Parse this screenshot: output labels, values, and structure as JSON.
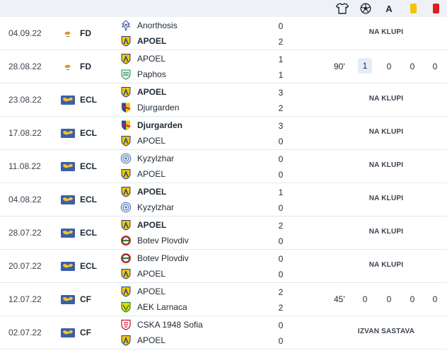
{
  "header_icons": [
    {
      "name": "shirt-icon"
    },
    {
      "name": "ball-icon"
    },
    {
      "name": "assist-icon",
      "text": "A"
    },
    {
      "name": "yellow-card-icon",
      "color": "#f5c400"
    },
    {
      "name": "red-card-icon",
      "color": "#e11d1d"
    }
  ],
  "matches": [
    {
      "date": "04.09.22",
      "flag": "cyprus",
      "comp": "FD",
      "home": {
        "name": "Anorthosis",
        "bold": false,
        "logo": "anorthosis"
      },
      "away": {
        "name": "APOEL",
        "bold": true,
        "logo": "apoel"
      },
      "score_home": "0",
      "score_away": "2",
      "status": "NA KLUPI"
    },
    {
      "date": "28.08.22",
      "flag": "cyprus",
      "comp": "FD",
      "home": {
        "name": "APOEL",
        "bold": false,
        "logo": "apoel"
      },
      "away": {
        "name": "Paphos",
        "bold": false,
        "logo": "paphos"
      },
      "score_home": "1",
      "score_away": "1",
      "stats": {
        "minute": "90'",
        "goals": "1",
        "assists": "0",
        "yellow": "0",
        "red": "0"
      }
    },
    {
      "date": "23.08.22",
      "flag": "europe",
      "comp": "ECL",
      "home": {
        "name": "APOEL",
        "bold": true,
        "logo": "apoel"
      },
      "away": {
        "name": "Djurgarden",
        "bold": false,
        "logo": "djurgarden"
      },
      "score_home": "3",
      "score_away": "2",
      "status": "NA KLUPI"
    },
    {
      "date": "17.08.22",
      "flag": "europe",
      "comp": "ECL",
      "home": {
        "name": "Djurgarden",
        "bold": true,
        "logo": "djurgarden"
      },
      "away": {
        "name": "APOEL",
        "bold": false,
        "logo": "apoel"
      },
      "score_home": "3",
      "score_away": "0",
      "status": "NA KLUPI"
    },
    {
      "date": "11.08.22",
      "flag": "europe",
      "comp": "ECL",
      "home": {
        "name": "Kyzylzhar",
        "bold": false,
        "logo": "kyzylzhar"
      },
      "away": {
        "name": "APOEL",
        "bold": false,
        "logo": "apoel"
      },
      "score_home": "0",
      "score_away": "0",
      "status": "NA KLUPI"
    },
    {
      "date": "04.08.22",
      "flag": "europe",
      "comp": "ECL",
      "home": {
        "name": "APOEL",
        "bold": true,
        "logo": "apoel"
      },
      "away": {
        "name": "Kyzylzhar",
        "bold": false,
        "logo": "kyzylzhar"
      },
      "score_home": "1",
      "score_away": "0",
      "status": "NA KLUPI"
    },
    {
      "date": "28.07.22",
      "flag": "europe",
      "comp": "ECL",
      "home": {
        "name": "APOEL",
        "bold": true,
        "logo": "apoel"
      },
      "away": {
        "name": "Botev Plovdiv",
        "bold": false,
        "logo": "botev"
      },
      "score_home": "2",
      "score_away": "0",
      "status": "NA KLUPI"
    },
    {
      "date": "20.07.22",
      "flag": "europe",
      "comp": "ECL",
      "home": {
        "name": "Botev Plovdiv",
        "bold": false,
        "logo": "botev"
      },
      "away": {
        "name": "APOEL",
        "bold": false,
        "logo": "apoel"
      },
      "score_home": "0",
      "score_away": "0",
      "status": "NA KLUPI"
    },
    {
      "date": "12.07.22",
      "flag": "europe",
      "comp": "CF",
      "home": {
        "name": "APOEL",
        "bold": false,
        "logo": "apoel"
      },
      "away": {
        "name": "AEK Larnaca",
        "bold": false,
        "logo": "aek"
      },
      "score_home": "2",
      "score_away": "2",
      "stats": {
        "minute": "45'",
        "goals": "0",
        "assists": "0",
        "yellow": "0",
        "red": "0"
      }
    },
    {
      "date": "02.07.22",
      "flag": "europe",
      "comp": "CF",
      "home": {
        "name": "CSKA 1948 Sofia",
        "bold": false,
        "logo": "cska"
      },
      "away": {
        "name": "APOEL",
        "bold": false,
        "logo": "apoel"
      },
      "score_home": "0",
      "score_away": "0",
      "status": "IZVAN SASTAVA"
    }
  ]
}
